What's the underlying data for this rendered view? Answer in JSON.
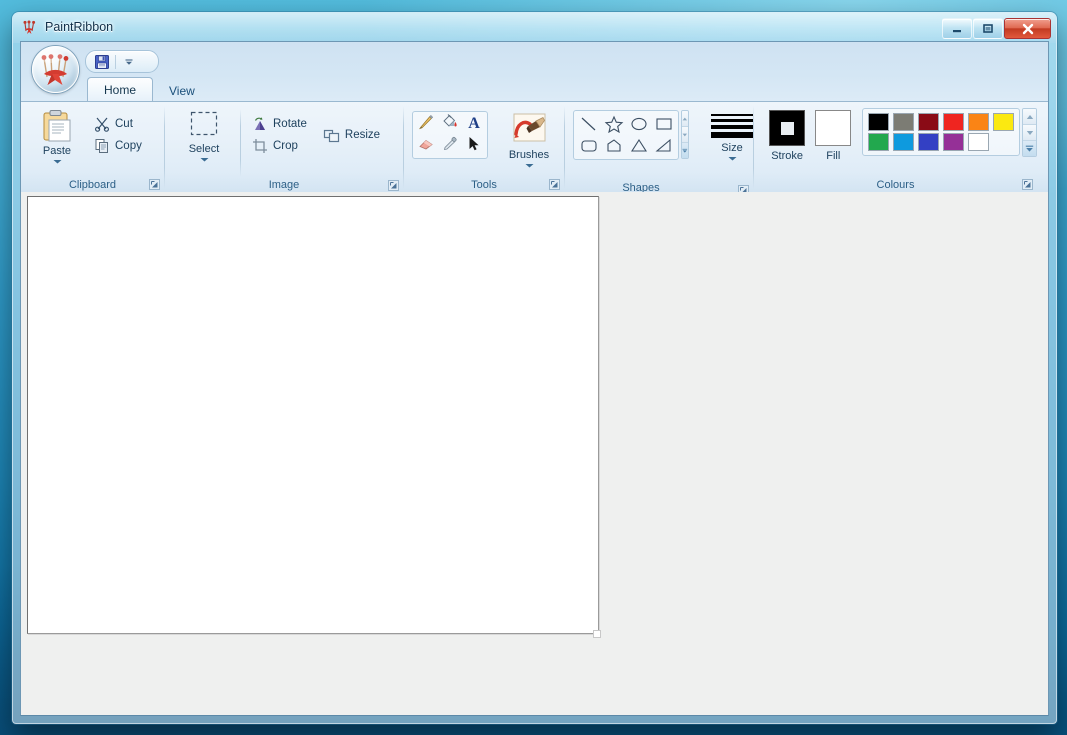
{
  "window": {
    "title": "PaintRibbon",
    "app_icon": "paint-ribbon-logo-icon",
    "buttons": {
      "minimize": "minimize-button",
      "maximize": "maximize-button",
      "close": "close-button"
    }
  },
  "quick_access": {
    "save_label": "Save",
    "save_icon": "floppy-disk-icon",
    "dropdown_icon": "chevron-down-icon"
  },
  "tabs": [
    {
      "label": "Home",
      "active": true
    },
    {
      "label": "View",
      "active": false
    }
  ],
  "groups": [
    {
      "name": "clipboard",
      "label": "Clipboard",
      "dialog_launcher": true,
      "big_buttons": [
        {
          "label": "Paste",
          "icon": "clipboard-paste-icon",
          "has_caret": true
        }
      ],
      "small_buttons": [
        {
          "label": "Cut",
          "icon": "scissors-icon"
        },
        {
          "label": "Copy",
          "icon": "copy-pages-icon"
        }
      ]
    },
    {
      "name": "image",
      "label": "Image",
      "dialog_launcher": true,
      "big_buttons": [
        {
          "label": "Select",
          "icon": "dashed-selection-icon",
          "has_caret": true
        }
      ],
      "small_buttons": [
        {
          "label": "Rotate",
          "icon": "rotate-image-icon"
        },
        {
          "label": "Crop",
          "icon": "crop-icon"
        },
        {
          "label": "Resize",
          "icon": "resize-icon"
        }
      ]
    },
    {
      "name": "tools",
      "label": "Tools",
      "dialog_launcher": true,
      "tools": [
        {
          "name": "pencil",
          "icon": "pencil-icon"
        },
        {
          "name": "fill",
          "icon": "paint-bucket-icon"
        },
        {
          "name": "text",
          "icon": "text-tool-icon"
        },
        {
          "name": "eraser",
          "icon": "eraser-icon"
        },
        {
          "name": "picker",
          "icon": "eyedropper-icon"
        },
        {
          "name": "select",
          "icon": "arrow-cursor-icon"
        }
      ],
      "big_buttons": [
        {
          "label": "Brushes",
          "icon": "paintbrush-icon",
          "has_caret": true
        }
      ]
    },
    {
      "name": "shapes",
      "label": "Shapes",
      "dialog_launcher": true,
      "shapes": [
        {
          "name": "line",
          "icon": "line-shape-icon"
        },
        {
          "name": "star",
          "icon": "star-shape-icon"
        },
        {
          "name": "ellipse",
          "icon": "ellipse-shape-icon"
        },
        {
          "name": "rectangle",
          "icon": "rectangle-shape-icon"
        },
        {
          "name": "rounded-rectangle",
          "icon": "rounded-rectangle-shape-icon"
        },
        {
          "name": "polygon",
          "icon": "polygon-shape-icon"
        },
        {
          "name": "triangle",
          "icon": "triangle-shape-icon"
        },
        {
          "name": "right-triangle",
          "icon": "right-triangle-shape-icon"
        }
      ],
      "scroll": {
        "up_icon": "scroll-up-icon",
        "down_icon": "scroll-down-icon",
        "more_icon": "show-more-icon"
      }
    },
    {
      "name": "size",
      "label": "Size",
      "button": {
        "label": "Size",
        "icon": "line-thickness-icon",
        "has_caret": true
      },
      "thicknesses": [
        2,
        3,
        4,
        6
      ]
    },
    {
      "name": "colours",
      "label": "Colours",
      "dialog_launcher": true,
      "stroke": {
        "label": "Stroke",
        "colour": "#000000"
      },
      "fill": {
        "label": "Fill",
        "colour": "#ffffff"
      },
      "palette": [
        "#000000",
        "#7c7c74",
        "#8a0b16",
        "#ef2520",
        "#fa8415",
        "#fbe911",
        "#22a84e",
        "#0e9ade",
        "#3340c4",
        "#953097",
        "#ffffff"
      ],
      "scroll": {
        "up_icon": "scroll-up-icon",
        "down_icon": "scroll-down-icon",
        "more_icon": "show-more-icon"
      }
    }
  ],
  "workspace": {
    "canvas_colour": "#ffffff",
    "background_colour": "#eff0ef",
    "resize_handle": "canvas-resize-handle"
  }
}
